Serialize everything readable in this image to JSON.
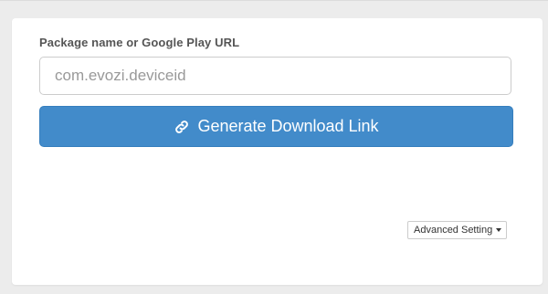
{
  "form": {
    "label": "Package name or Google Play URL",
    "input_placeholder": "com.evozi.deviceid",
    "input_value": ""
  },
  "generate_button": {
    "label": "Generate Download Link",
    "icon": "link-icon",
    "color": "#428bca"
  },
  "advanced_setting": {
    "label": "Advanced Setting",
    "icon": "caret-down-icon"
  }
}
